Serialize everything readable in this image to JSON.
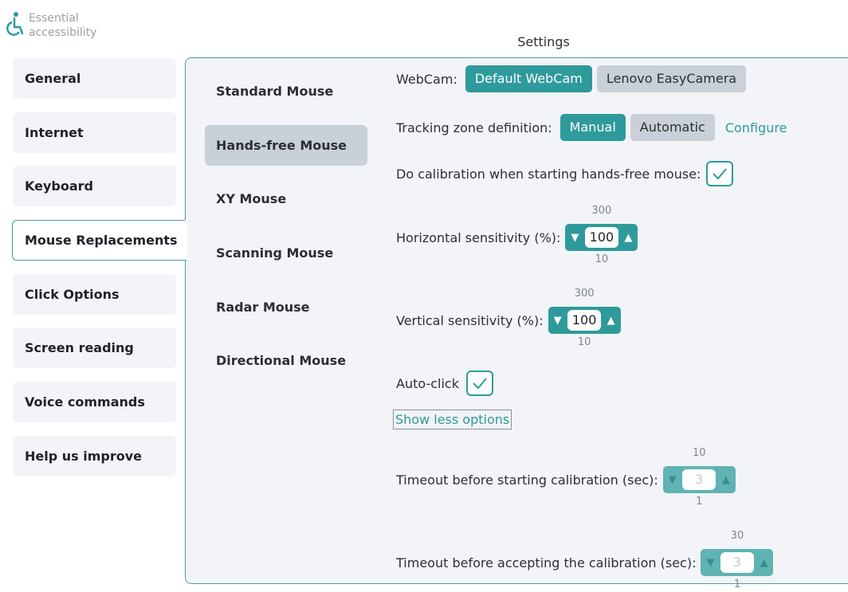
{
  "brand": {
    "line1": "Essential",
    "line2": "accessibility",
    "logo_icon": "wheelchair-icon"
  },
  "title": "Settings",
  "sidebar": {
    "items": [
      {
        "label": "General"
      },
      {
        "label": "Internet"
      },
      {
        "label": "Keyboard"
      },
      {
        "label": "Mouse Replacements",
        "active": true
      },
      {
        "label": "Click Options"
      },
      {
        "label": "Screen reading"
      },
      {
        "label": "Voice commands"
      },
      {
        "label": "Help us improve"
      }
    ]
  },
  "submenu": {
    "items": [
      {
        "label": "Standard Mouse"
      },
      {
        "label": "Hands-free Mouse",
        "active": true
      },
      {
        "label": "XY Mouse"
      },
      {
        "label": "Scanning Mouse"
      },
      {
        "label": "Radar Mouse"
      },
      {
        "label": "Directional Mouse"
      }
    ]
  },
  "settings": {
    "webcam": {
      "label": "WebCam:",
      "options": [
        "Default WebCam",
        "Lenovo EasyCamera"
      ],
      "selected": "Default WebCam"
    },
    "tracking": {
      "label": "Tracking zone definition:",
      "options": [
        "Manual",
        "Automatic"
      ],
      "selected": "Manual",
      "configure": "Configure"
    },
    "calibration": {
      "label": "Do calibration when starting hands-free mouse:",
      "checked": true
    },
    "horizontal": {
      "label": "Horizontal sensitivity (%):",
      "value": "100",
      "max": "300",
      "min": "10"
    },
    "vertical": {
      "label": "Vertical sensitivity (%):",
      "value": "100",
      "max": "300",
      "min": "10"
    },
    "autoclick": {
      "label": "Auto-click",
      "checked": true
    },
    "show_less": "Show less options",
    "timeout_start": {
      "label": "Timeout before starting calibration (sec):",
      "value": "3",
      "max": "10",
      "min": "1"
    },
    "timeout_accept": {
      "label": "Timeout before accepting the calibration (sec):",
      "value": "3",
      "max": "30",
      "min": "1"
    }
  },
  "colors": {
    "accent": "#2f9a9b",
    "panel": "#f2f4f7",
    "border": "#4a9d9c",
    "secondary_btn": "#c9d0d7"
  }
}
